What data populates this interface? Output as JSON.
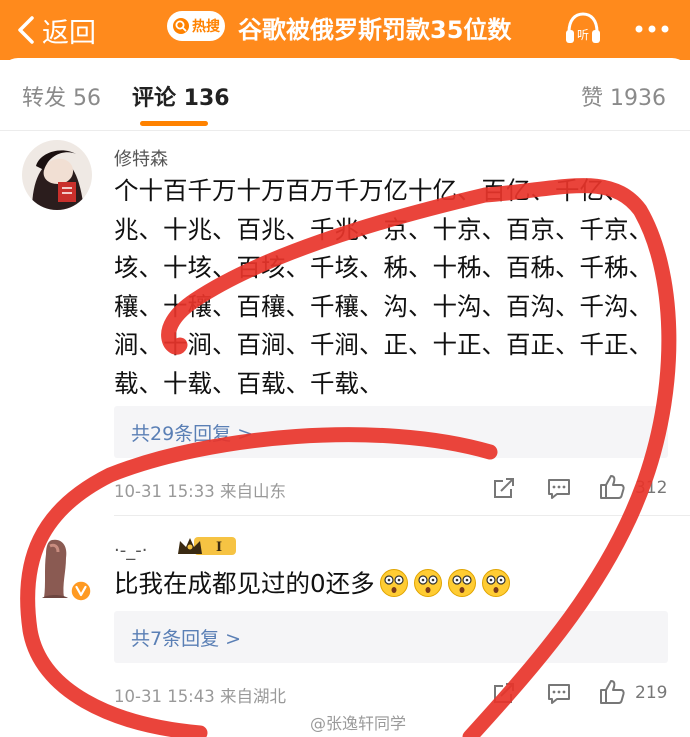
{
  "header": {
    "back_label": "返回",
    "hot_badge": "热搜",
    "title": "谷歌被俄罗斯罚款35位数",
    "listen_label": "听",
    "accent": "#ff8a1c"
  },
  "tabs": {
    "forward": "转发 56",
    "comment": "评论 136",
    "like": "赞 1936"
  },
  "comments": [
    {
      "username": "修特森",
      "text": "个十百千万十万百万千万亿十亿、百亿、千亿、兆、十兆、百兆、千兆、京、十京、百京、千京、垓、十垓、百垓、千垓、秭、十秭、百秭、千秭、穰、十穰、百穰、千穰、沟、十沟、百沟、千沟、涧、十涧、百涧、千涧、正、十正、百正、千正、载、十载、百载、千载、",
      "replies": "共29条回复 >",
      "time_location": "10-31 15:33  来自山东",
      "likes": "312"
    },
    {
      "username": "·-_-·",
      "badge_level": "I",
      "text": "比我在成都见过的0还多",
      "replies": "共7条回复 >",
      "time_location": "10-31 15:43  来自湖北",
      "likes": "219"
    }
  ],
  "watermark": "@张逸轩同学",
  "annotation_color": "#e8342a"
}
